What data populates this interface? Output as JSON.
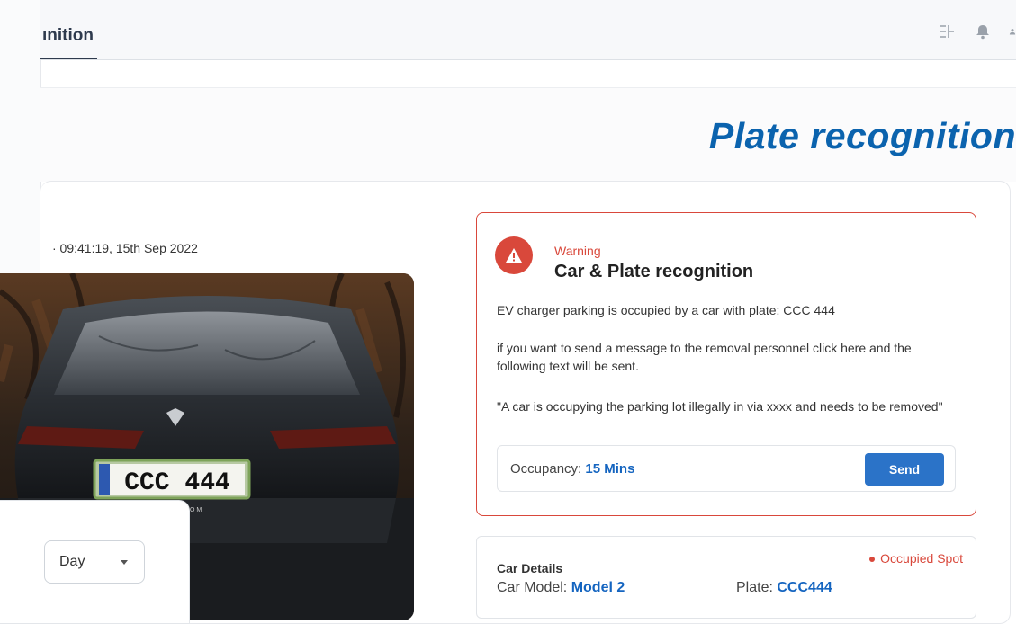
{
  "topbar": {
    "active_tab": "ınition",
    "icons": [
      "columns-icon",
      "bell-icon",
      "user-icon"
    ]
  },
  "hero": {
    "title": "Plate recognition"
  },
  "capture": {
    "timestamp": "· 09:41:19, 15th Sep 2022",
    "plate_on_car": "CCC 444",
    "plate_small_text": "TESLA.COM"
  },
  "filter": {
    "period_value": "Day"
  },
  "warning": {
    "label": "Warning",
    "title": "Car & Plate recognition",
    "line1": "EV charger parking is occupied by a car with plate: CCC 444",
    "line2": "if you want to send a message to the removal personnel click here and the following text will be sent.",
    "line3": "\"A car is occupying the parking lot illegally in via xxxx and needs to be removed\"",
    "occupancy_label": "Occupancy:",
    "occupancy_value": "15 Mins",
    "send_label": "Send"
  },
  "details": {
    "title": "Car Details",
    "model_label": "Car Model:",
    "model_value": "Model 2",
    "plate_label": "Plate:",
    "plate_value": "CCC444",
    "status": "Occupied Spot"
  },
  "colors": {
    "accent": "#0b63ae",
    "danger": "#d9483b",
    "button": "#2b73c8"
  }
}
